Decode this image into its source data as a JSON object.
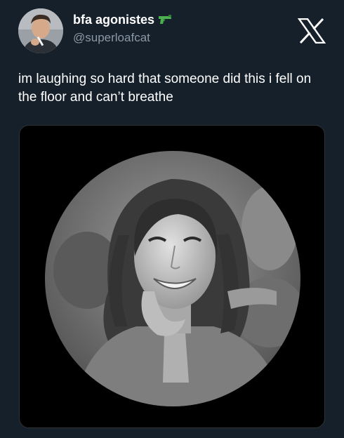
{
  "post": {
    "display_name": "bfa agonistes",
    "display_name_emoji": "water-pistol-icon",
    "handle": "@superloafcat",
    "text": "im laughing so hard that someone did this i fell on the floor and can’t breathe",
    "platform_logo": "x-logo-icon",
    "media": {
      "kind": "circular-cropped-photo",
      "description_icon": "portrait-photo"
    }
  },
  "colors": {
    "background": "#15202b",
    "text_primary": "#ffffff",
    "text_secondary": "#8b98a5",
    "media_background": "#000000",
    "emoji_green": "#4caf50"
  }
}
